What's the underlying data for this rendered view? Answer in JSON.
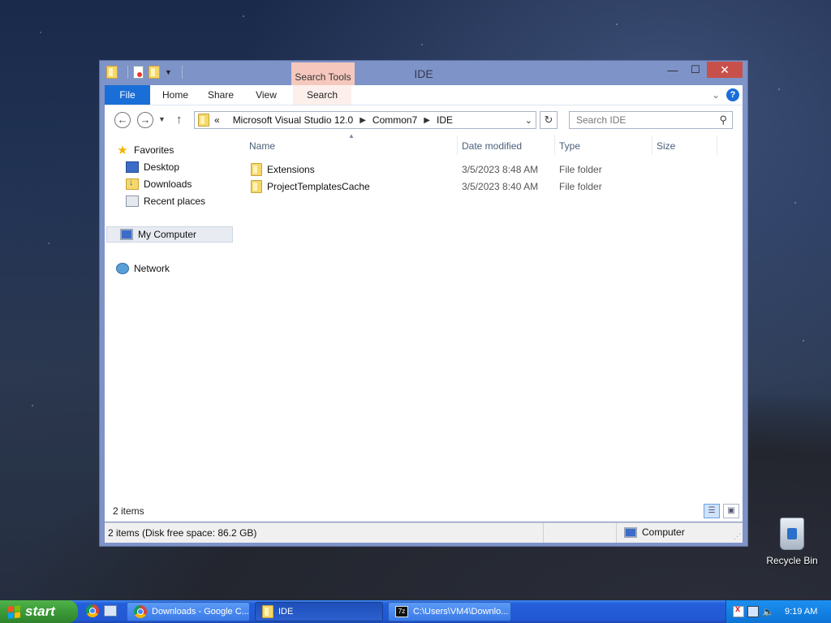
{
  "window": {
    "title": "IDE",
    "context_tab_group": "Search Tools",
    "tabs": {
      "file": "File",
      "home": "Home",
      "share": "Share",
      "view": "View",
      "search": "Search"
    },
    "controls": {
      "minimize": "—",
      "maximize": "☐",
      "close": "✕"
    },
    "help": "?"
  },
  "address": {
    "overflow": "«",
    "crumbs": [
      "Microsoft Visual Studio 12.0",
      "Common7",
      "IDE"
    ],
    "search_placeholder": "Search IDE"
  },
  "nav_pane": {
    "favorites": "Favorites",
    "desktop": "Desktop",
    "downloads": "Downloads",
    "recent": "Recent places",
    "my_computer": "My Computer",
    "network": "Network"
  },
  "columns": {
    "name": "Name",
    "date": "Date modified",
    "type": "Type",
    "size": "Size"
  },
  "files": [
    {
      "name": "Extensions",
      "date": "3/5/2023 8:48 AM",
      "type": "File folder",
      "size": ""
    },
    {
      "name": "ProjectTemplatesCache",
      "date": "3/5/2023 8:40 AM",
      "type": "File folder",
      "size": ""
    }
  ],
  "items_count": "2 items",
  "status": {
    "left": "2 items (Disk free space: 86.2 GB)",
    "right": "Computer"
  },
  "desktop": {
    "recycle_bin": "Recycle Bin"
  },
  "taskbar": {
    "start": "start",
    "buttons": [
      "Downloads - Google C...",
      "IDE",
      "C:\\Users\\VM4\\Downlo..."
    ],
    "clock": "9:19 AM"
  }
}
